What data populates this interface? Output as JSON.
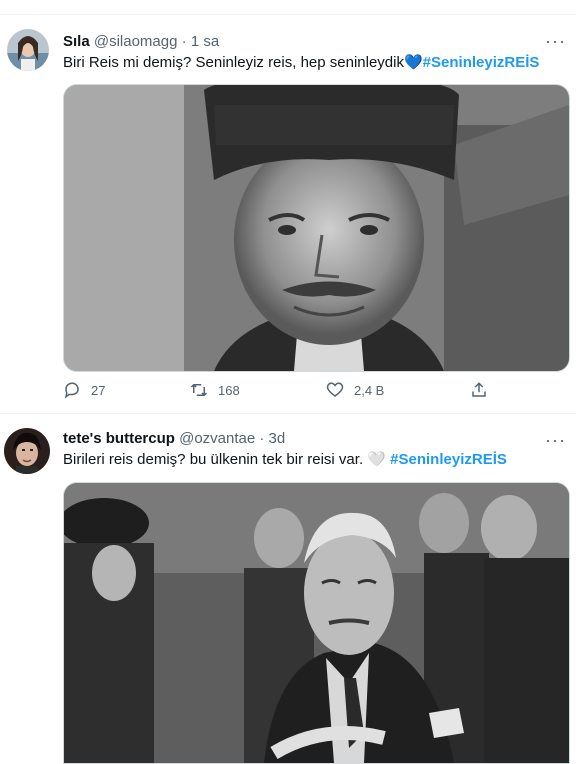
{
  "tweets": [
    {
      "name": "Sıla",
      "handle": "@silaomagg",
      "dot": "·",
      "time": "1 sa",
      "text": "Biri Reis mi demiş? Seninleyiz reis, hep seninleydik",
      "emoji": "💙",
      "hashtag": "#SeninleyizREİS",
      "reply_count": "27",
      "retweet_count": "168",
      "like_count": "2,4 B"
    },
    {
      "name": "tete's buttercup",
      "handle": "@ozvantae",
      "dot": "·",
      "time": "3d",
      "text": "Birileri reis demiş? bu ülkenin tek bir reisi var.",
      "emoji": "🤍",
      "hashtag": "#SeninleyizREİS"
    }
  ],
  "more_label": "···",
  "colors": {
    "hashtag": "#1d9bf0",
    "muted": "#536471",
    "divider": "#eff3f4"
  },
  "icons": [
    "more-icon",
    "reply-icon",
    "retweet-icon",
    "like-icon",
    "share-icon"
  ]
}
